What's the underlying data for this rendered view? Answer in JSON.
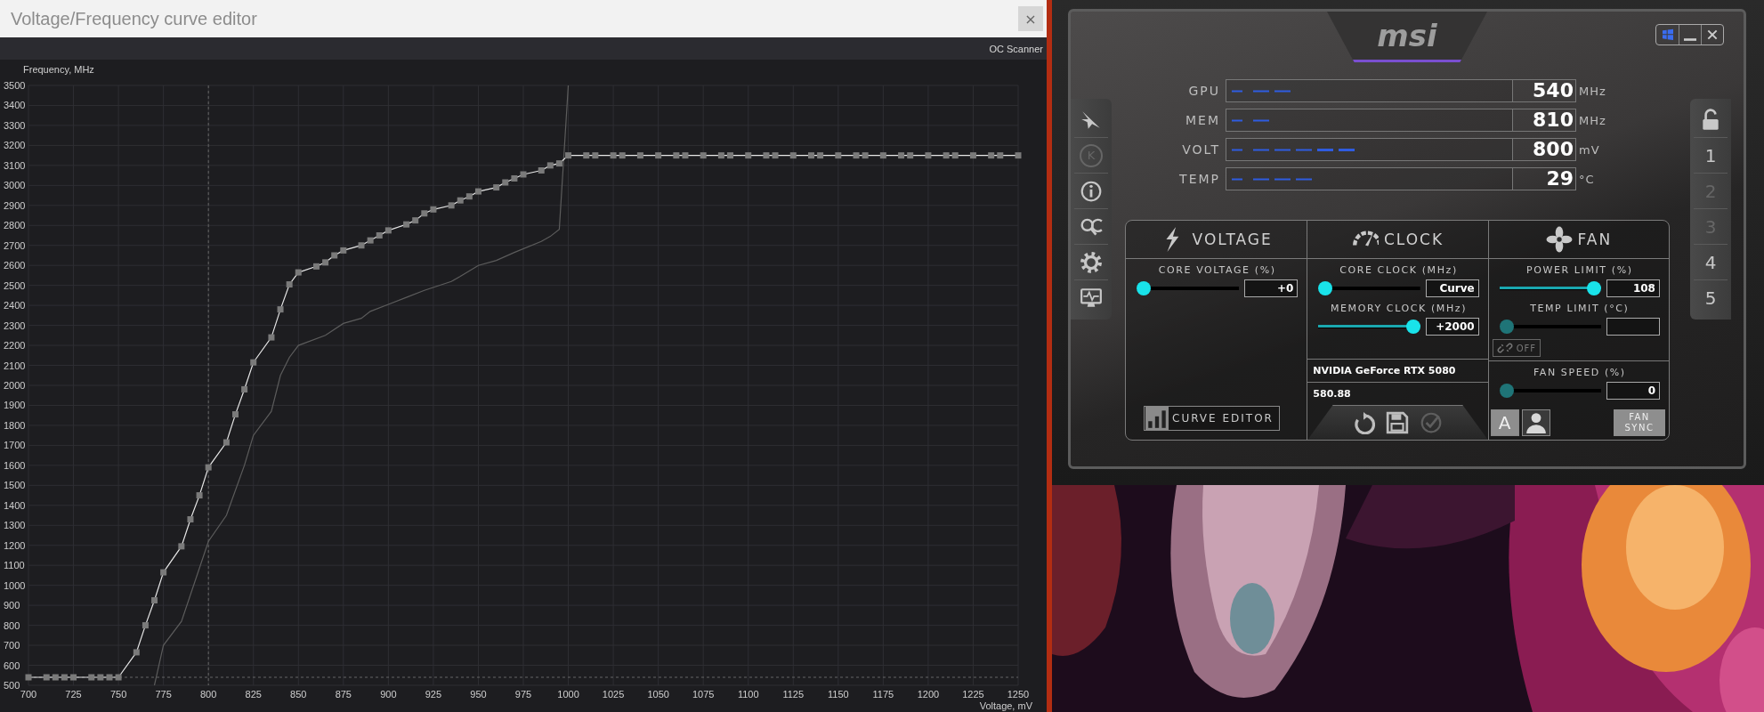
{
  "editor": {
    "title": "Voltage/Frequency curve editor",
    "close": "×",
    "toolbar": [
      "OC Scanner"
    ],
    "chart_data": {
      "type": "line",
      "xlabel": "Voltage, mV",
      "ylabel": "Frequency, MHz",
      "xlim": [
        700,
        1250
      ],
      "ylim": [
        500,
        3500
      ],
      "xticks": [
        700,
        725,
        750,
        775,
        800,
        825,
        850,
        875,
        900,
        925,
        950,
        975,
        1000,
        1025,
        1050,
        1075,
        1100,
        1125,
        1150,
        1175,
        1200,
        1225,
        1250
      ],
      "yticks": [
        500,
        600,
        700,
        800,
        900,
        1000,
        1100,
        1200,
        1300,
        1400,
        1500,
        1600,
        1700,
        1800,
        1900,
        2000,
        2100,
        2200,
        2300,
        2400,
        2500,
        2600,
        2700,
        2800,
        2900,
        3000,
        3100,
        3200,
        3300,
        3400,
        3500
      ],
      "x": [
        700,
        710,
        715,
        720,
        725,
        735,
        740,
        745,
        750,
        760,
        765,
        770,
        775,
        785,
        790,
        795,
        800,
        810,
        815,
        820,
        825,
        835,
        840,
        845,
        850,
        860,
        865,
        870,
        875,
        885,
        890,
        895,
        900,
        910,
        915,
        920,
        925,
        935,
        940,
        945,
        950,
        960,
        965,
        970,
        975,
        985,
        990,
        995,
        1000,
        1010,
        1015,
        1025,
        1030,
        1040,
        1050,
        1060,
        1065,
        1075,
        1085,
        1090,
        1100,
        1110,
        1115,
        1125,
        1135,
        1140,
        1150,
        1160,
        1165,
        1175,
        1185,
        1190,
        1200,
        1210,
        1215,
        1225,
        1235,
        1240,
        1250
      ],
      "series": [
        {
          "color": "#e6e6e6",
          "marker": true,
          "values": [
            540,
            540,
            540,
            540,
            540,
            540,
            540,
            540,
            540,
            665,
            800,
            925,
            1065,
            1195,
            1330,
            1450,
            1590,
            1715,
            1855,
            1980,
            2115,
            2240,
            2380,
            2505,
            2565,
            2595,
            2615,
            2650,
            2675,
            2700,
            2725,
            2750,
            2775,
            2805,
            2825,
            2860,
            2880,
            2900,
            2925,
            2945,
            2970,
            2990,
            3015,
            3035,
            3055,
            3075,
            3100,
            3110,
            3150,
            3150,
            3150,
            3150,
            3150,
            3150,
            3150,
            3150,
            3150,
            3150,
            3150,
            3150,
            3150,
            3150,
            3150,
            3150,
            3150,
            3150,
            3150,
            3150,
            3150,
            3150,
            3150,
            3150,
            3150,
            3150,
            3150,
            3150,
            3150,
            3150,
            3150
          ]
        },
        {
          "color": "#5c5c5c",
          "marker": false,
          "values": [
            null,
            null,
            null,
            null,
            null,
            null,
            null,
            null,
            null,
            null,
            null,
            500,
            700,
            820,
            null,
            null,
            1220,
            1350,
            null,
            1600,
            1750,
            1870,
            2050,
            2140,
            2200,
            null,
            2250,
            null,
            2310,
            2335,
            2370,
            null,
            2405,
            2440,
            null,
            2475,
            null,
            2520,
            2545,
            null,
            2600,
            2625,
            null,
            2665,
            null,
            2720,
            2745,
            2780,
            3500,
            null,
            null,
            null,
            null,
            null,
            null,
            null,
            null,
            null,
            null,
            null,
            null,
            null,
            null,
            null,
            null,
            null,
            null,
            null,
            null,
            null,
            null,
            null,
            null,
            null,
            null,
            null,
            null,
            null,
            null
          ]
        }
      ],
      "ref_lines": [
        {
          "axis": "x",
          "value": 800
        },
        {
          "axis": "y",
          "value": 540
        }
      ],
      "grid": true
    }
  },
  "afterburner": {
    "logo": "msi",
    "window_buttons": [
      {
        "kind": "windows"
      },
      {
        "kind": "minimize"
      },
      {
        "kind": "close"
      }
    ],
    "monitor": [
      {
        "label": "GPU",
        "value": "540",
        "unit": "MHz"
      },
      {
        "label": "MEM",
        "value": "810",
        "unit": "MHz"
      },
      {
        "label": "VOLT",
        "value": "800",
        "unit": "mV"
      },
      {
        "label": "TEMP",
        "value": "29",
        "unit": "°C"
      }
    ],
    "left_rail": [
      {
        "kind": "jet",
        "disabled": false
      },
      {
        "kind": "letter",
        "label": "K",
        "disabled": true
      },
      {
        "kind": "info",
        "disabled": false
      },
      {
        "kind": "scan",
        "disabled": false
      },
      {
        "kind": "settings",
        "disabled": false
      },
      {
        "kind": "monitor",
        "disabled": false
      }
    ],
    "right_rail": [
      {
        "kind": "lock",
        "disabled": false
      },
      {
        "kind": "profile",
        "label": "1",
        "disabled": false
      },
      {
        "kind": "profile",
        "label": "2",
        "disabled": true
      },
      {
        "kind": "profile",
        "label": "3",
        "disabled": true
      },
      {
        "kind": "profile",
        "label": "4",
        "disabled": false
      },
      {
        "kind": "profile",
        "label": "5",
        "disabled": false
      }
    ],
    "sections": [
      {
        "kind": "voltage",
        "title": "VOLTAGE",
        "sliders": [
          {
            "label": "CORE VOLTAGE (%)",
            "level": 0,
            "value": "+0",
            "disabled": false
          }
        ],
        "curve_editor": "CURVE EDITOR"
      },
      {
        "kind": "clock",
        "title": "CLOCK",
        "sliders": [
          {
            "label": "CORE CLOCK (MHz)",
            "level": 0,
            "value": "Curve",
            "disabled": false
          },
          {
            "label": "MEMORY CLOCK (MHz)",
            "level": 1,
            "value": "+2000",
            "disabled": false
          }
        ],
        "gpu": "NVIDIA GeForce RTX 5080",
        "driver": "580.88"
      },
      {
        "kind": "fan",
        "title": "FAN",
        "sliders": [
          {
            "label": "POWER LIMIT (%)",
            "level": 1,
            "value": "108",
            "disabled": false
          },
          {
            "label": "TEMP LIMIT (°C)",
            "level": 0,
            "disabled": true
          }
        ],
        "link_toggle": {
          "label": "OFF",
          "on": false
        },
        "fan_speed": {
          "label": "FAN SPEED (%)",
          "level": 0,
          "value": "0",
          "disabled": true
        },
        "auto_button": {
          "label": "A",
          "selected": true
        },
        "user_button": {
          "selected": false
        },
        "fan_sync": "FAN SYNC"
      }
    ],
    "actions": [
      {
        "kind": "reset",
        "disabled": false
      },
      {
        "kind": "save",
        "disabled": false
      },
      {
        "kind": "apply",
        "disabled": true
      }
    ]
  }
}
